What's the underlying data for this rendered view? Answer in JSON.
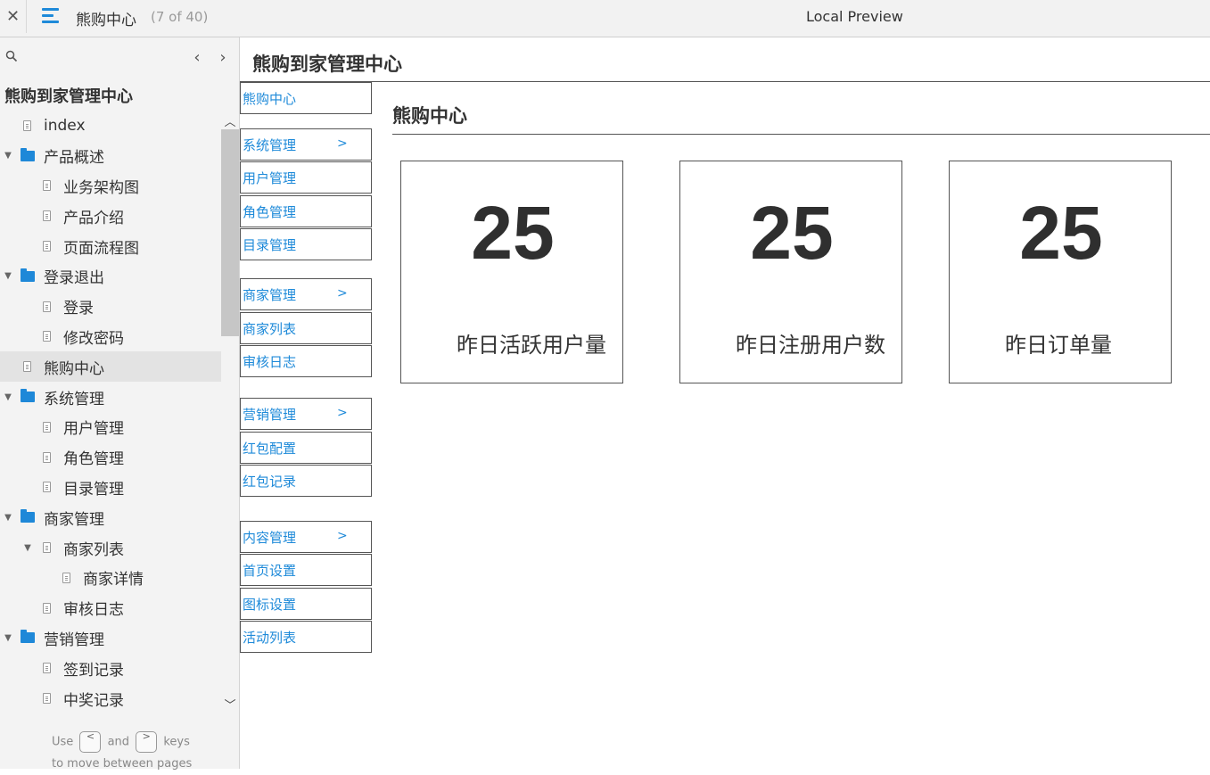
{
  "topbar": {
    "project": "熊购中心",
    "page_count": "(7 of 40)",
    "center_title": "Local Preview"
  },
  "sidebar": {
    "project_title": "熊购到家管理中心",
    "hint_use": "Use",
    "hint_and": "and",
    "hint_keys": "keys",
    "hint_move": "to move between pages",
    "key_prev": "<",
    "key_next": ">",
    "tree": [
      {
        "label": "index",
        "type": "page",
        "depth": 0
      },
      {
        "label": "产品概述",
        "type": "folder",
        "depth": 0
      },
      {
        "label": "业务架构图",
        "type": "page",
        "depth": 1
      },
      {
        "label": "产品介绍",
        "type": "page",
        "depth": 1
      },
      {
        "label": "页面流程图",
        "type": "page",
        "depth": 1
      },
      {
        "label": "登录退出",
        "type": "folder",
        "depth": 0
      },
      {
        "label": "登录",
        "type": "page",
        "depth": 1
      },
      {
        "label": "修改密码",
        "type": "page",
        "depth": 1
      },
      {
        "label": "熊购中心",
        "type": "page",
        "depth": 0,
        "selected": true
      },
      {
        "label": "系统管理",
        "type": "folder",
        "depth": 0
      },
      {
        "label": "用户管理",
        "type": "page",
        "depth": 1
      },
      {
        "label": "角色管理",
        "type": "page",
        "depth": 1
      },
      {
        "label": "目录管理",
        "type": "page",
        "depth": 1
      },
      {
        "label": "商家管理",
        "type": "folder",
        "depth": 0
      },
      {
        "label": "商家列表",
        "type": "page",
        "depth": 1,
        "expandable": true
      },
      {
        "label": "商家详情",
        "type": "page",
        "depth": 2
      },
      {
        "label": "审核日志",
        "type": "page",
        "depth": 1
      },
      {
        "label": "营销管理",
        "type": "folder",
        "depth": 0
      },
      {
        "label": "签到记录",
        "type": "page",
        "depth": 1
      },
      {
        "label": "中奖记录",
        "type": "page",
        "depth": 1
      }
    ]
  },
  "main": {
    "title": "熊购到家管理中心",
    "content_title": "熊购中心",
    "menu": [
      {
        "label": "熊购中心"
      },
      {
        "label": "系统管理",
        "chev": ">"
      },
      {
        "label": "用户管理"
      },
      {
        "label": "角色管理"
      },
      {
        "label": "目录管理"
      },
      {
        "label": "商家管理",
        "chev": ">"
      },
      {
        "label": "商家列表"
      },
      {
        "label": "审核日志"
      },
      {
        "label": "营销管理",
        "chev": ">"
      },
      {
        "label": "红包配置"
      },
      {
        "label": "红包记录"
      },
      {
        "label": "内容管理",
        "chev": ">"
      },
      {
        "label": "首页设置"
      },
      {
        "label": "图标设置"
      },
      {
        "label": "活动列表"
      }
    ],
    "stats": [
      {
        "value": "25",
        "label": "昨日活跃用户量"
      },
      {
        "value": "25",
        "label": "昨日注册用户数"
      },
      {
        "value": "25",
        "label": "昨日订单量"
      }
    ]
  },
  "colors": {
    "accent": "#1e8ad9",
    "folder": "#1e88d8",
    "selected_bg": "#e3e3e3",
    "sidebar_bg": "#f3f3f3"
  }
}
